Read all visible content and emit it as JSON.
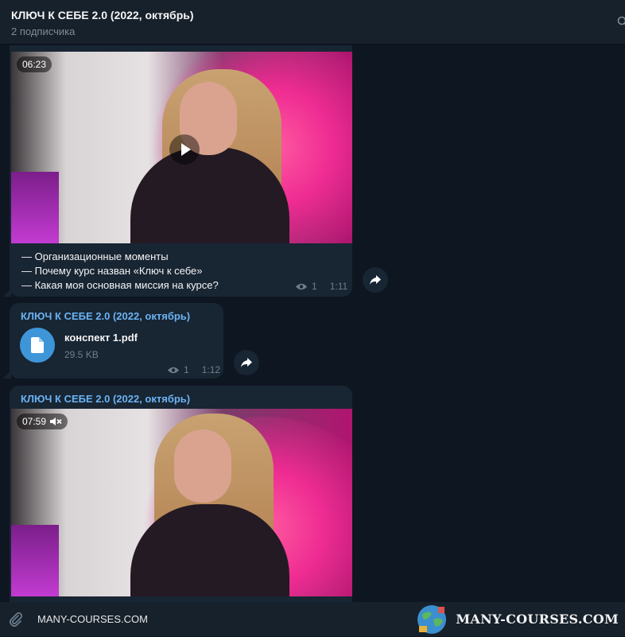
{
  "header": {
    "title": "КЛЮЧ К СЕБЕ 2.0 (2022, октябрь)",
    "subtitle": "2 подписчика"
  },
  "messages": [
    {
      "video": {
        "duration": "06:23"
      },
      "caption": [
        "— Организационные моменты",
        "— Почему курс назван «Ключ к себе»",
        "— Какая моя основная миссия на курсе?"
      ],
      "views": "1",
      "time": "1:11"
    },
    {
      "sender": "КЛЮЧ К СЕБЕ 2.0 (2022, октябрь)",
      "file": {
        "name": "конспект 1.pdf",
        "size": "29.5 KB"
      },
      "views": "1",
      "time": "1:12"
    },
    {
      "sender": "КЛЮЧ К СЕБЕ 2.0 (2022, октябрь)",
      "video": {
        "duration": "07:59",
        "muted": true
      }
    }
  ],
  "input": {
    "text": "MANY-COURSES.COM"
  },
  "watermark": {
    "text": "MANY-COURSES.COM"
  },
  "colors": {
    "background": "#0e1621",
    "bubble": "#182533",
    "accent": "#6ab3f3"
  }
}
